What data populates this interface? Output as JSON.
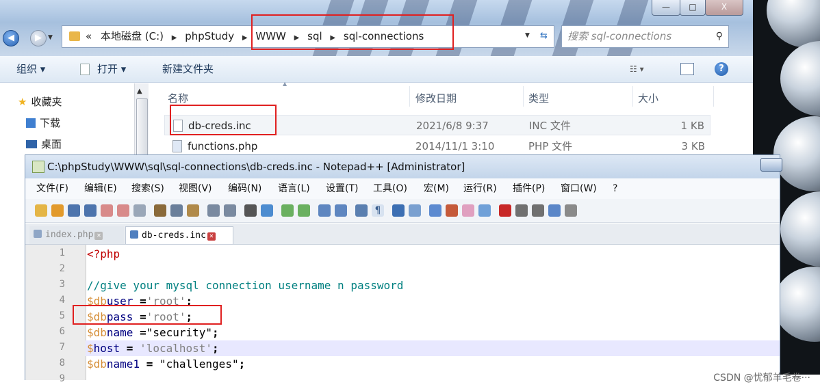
{
  "explorer": {
    "window_controls": {
      "minimize": "—",
      "maximize": "□",
      "close": "X"
    },
    "nav": {
      "back": "◀",
      "forward": "▶"
    },
    "address": {
      "prefix": "«",
      "crumbs": [
        "本地磁盘 (C:)",
        "phpStudy",
        "WWW",
        "sql",
        "sql-connections"
      ]
    },
    "search_placeholder": "搜索 sql-connections",
    "toolbar": {
      "organize": "组织 ▾",
      "open": "打开 ▾",
      "new_folder": "新建文件夹",
      "help": "?"
    },
    "nav_pane": {
      "favorites": "收藏夹",
      "downloads": "下载",
      "desktop": "桌面"
    },
    "columns": {
      "name": "名称",
      "date": "修改日期",
      "type": "类型",
      "size": "大小"
    },
    "files": [
      {
        "name": "db-creds.inc",
        "date": "2021/6/8 9:37",
        "type": "INC 文件",
        "size": "1 KB"
      },
      {
        "name": "functions.php",
        "date": "2014/11/1 3:10",
        "type": "PHP 文件",
        "size": "3 KB"
      }
    ]
  },
  "notepad": {
    "title": "C:\\phpStudy\\WWW\\sql\\sql-connections\\db-creds.inc - Notepad++ [Administrator]",
    "menu": [
      "文件(F)",
      "编辑(E)",
      "搜索(S)",
      "视图(V)",
      "编码(N)",
      "语言(L)",
      "设置(T)",
      "工具(O)",
      "宏(M)",
      "运行(R)",
      "插件(P)",
      "窗口(W)",
      "?"
    ],
    "tabs": [
      {
        "label": "index.php",
        "active": false
      },
      {
        "label": "db-creds.inc",
        "active": true
      }
    ],
    "line_numbers": [
      "1",
      "2",
      "3",
      "4",
      "5",
      "6",
      "7",
      "8",
      "9"
    ],
    "code": {
      "l1_tag": "<?php",
      "l3_comment": "//give your mysql connection username n password",
      "l4_var": "$db",
      "l4_id": "user",
      "l4_op": " =",
      "l4_str": "'root'",
      "l4_end": ";",
      "l5_var": "$db",
      "l5_id": "pass",
      "l5_op": " =",
      "l5_str": "'root'",
      "l5_end": ";",
      "l6_var": "$db",
      "l6_id": "name",
      "l6_op": " =",
      "l6_str": "\"security\"",
      "l6_end": ";",
      "l7_var": "$",
      "l7_id": "host",
      "l7_op": " = ",
      "l7_str": "'localhost'",
      "l7_end": ";",
      "l8_var": "$db",
      "l8_id": "name1",
      "l8_op": " = ",
      "l8_str": "\"challenges\"",
      "l8_end": ";"
    }
  },
  "watermark": "CSDN @忧郁羊毛卷···",
  "colors": {
    "annotation": "#e02020",
    "comment": "#008080",
    "variable": "#d6903a",
    "string": "#808080"
  }
}
